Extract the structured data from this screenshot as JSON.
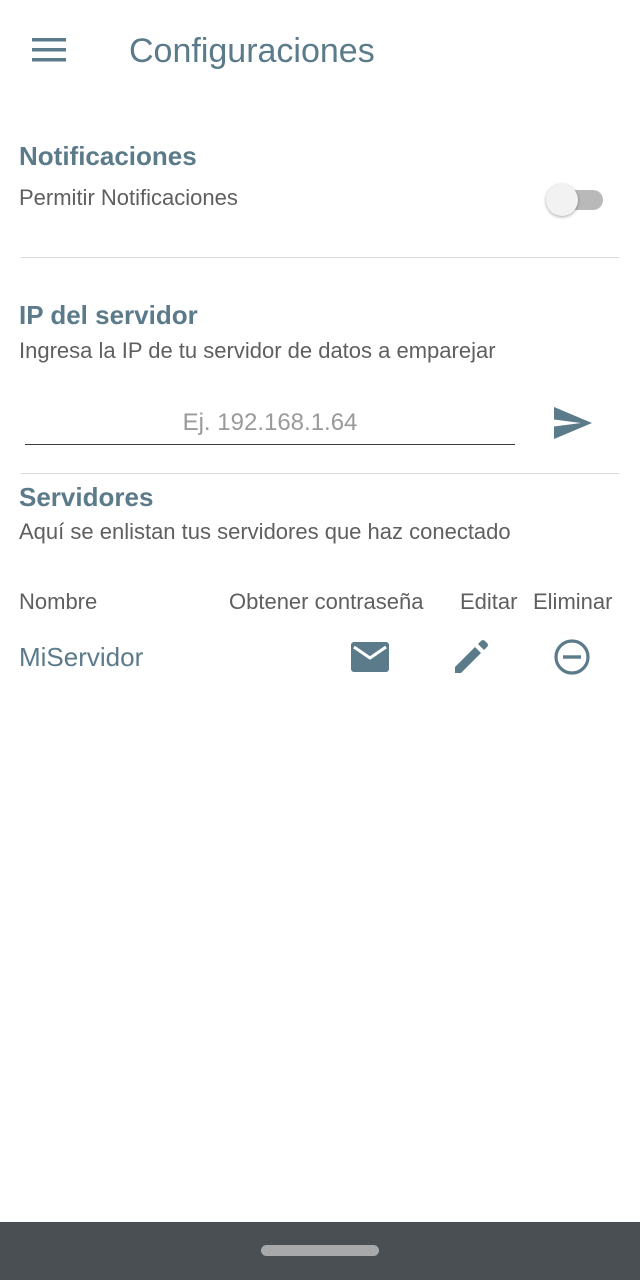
{
  "header": {
    "title": "Configuraciones",
    "menu_icon": "hamburger-menu-icon"
  },
  "notifications": {
    "title": "Notificaciones",
    "toggle_label": "Permitir Notificaciones",
    "toggle_on": false
  },
  "server_ip": {
    "title": "IP del servidor",
    "description": "Ingresa la IP de tu servidor de datos a emparejar",
    "input_value": "",
    "input_placeholder": "Ej. 192.168.1.64",
    "send_icon": "send-icon"
  },
  "servers": {
    "title": "Servidores",
    "description": "Aquí se enlistan tus servidores que haz conectado",
    "columns": [
      "Nombre",
      "Obtener contraseña",
      "Editar",
      "Eliminar"
    ],
    "rows": [
      {
        "name": "MiServidor",
        "get_password_icon": "mail-icon",
        "edit_icon": "pencil-icon",
        "delete_icon": "remove-circle-icon"
      }
    ]
  },
  "colors": {
    "accent": "#5b7a8a",
    "body_text": "#5f5f5f",
    "divider": "#d9d9d9",
    "nav_bar": "#4a4f54"
  }
}
